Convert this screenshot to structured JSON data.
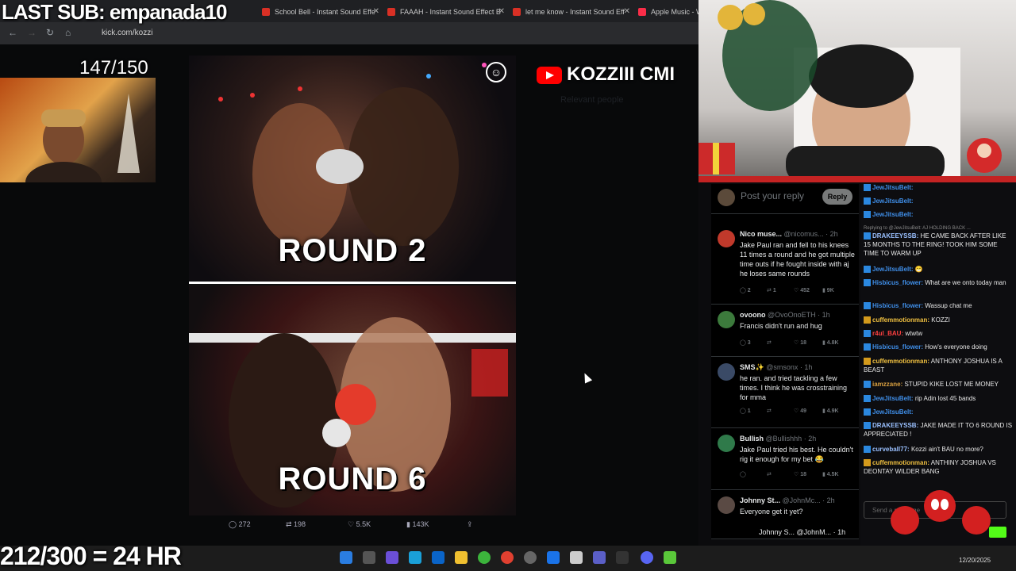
{
  "overlay": {
    "last_sub": "LAST SUB: empanada10",
    "goal_top": "147/150",
    "goal_bottom": "212/300 = 24 HR"
  },
  "browser": {
    "tabs": [
      {
        "label": "School Bell - Instant Sound Effe"
      },
      {
        "label": "FAAAH - Instant Sound Effect B"
      },
      {
        "label": "let me know - Instant Sound Eff"
      },
      {
        "label": "Apple Music - W"
      }
    ],
    "url": "kick.com/kozzi"
  },
  "post": {
    "round_top": "ROUND 2",
    "round_bottom": "ROUND 6",
    "replies": "272",
    "reposts": "198",
    "likes": "5.5K",
    "views": "143K"
  },
  "social_banner": "KOZZIII  CMI",
  "reply_box": {
    "placeholder": "Post your reply",
    "button": "Reply"
  },
  "tweets": [
    {
      "name": "Nico muse...",
      "handle": "@nicomus... · 2h",
      "text": "Jake Paul ran and fell to his knees 11 times a round and he got multiple time outs if he fought inside with aj he loses same rounds",
      "replies": "2",
      "reposts": "1",
      "likes": "452",
      "views": "9K",
      "color": "#c0392b"
    },
    {
      "name": "ovoono",
      "handle": "@OvoOnoETH · 1h",
      "text": "Francis didn't run and hug",
      "replies": "3",
      "reposts": "",
      "likes": "18",
      "views": "4.8K",
      "color": "#3c7a3c"
    },
    {
      "name": "SMS✨",
      "handle": "@smsonx · 1h",
      "text": "he ran. and tried tackling a few times. I think he was crosstraining for mma",
      "replies": "1",
      "reposts": "",
      "likes": "49",
      "views": "4.9K",
      "color": "#3a4a66"
    },
    {
      "name": "Bullish",
      "handle": "@Bullishhh · 2h",
      "text": "Jake Paul tried his best. He couldn't rig it enough for my bet 😂",
      "replies": "",
      "reposts": "",
      "likes": "18",
      "views": "4.5K",
      "color": "#2f7a4a"
    },
    {
      "name": "Johnny St...",
      "handle": "@JohnMc... · 2h",
      "text": "Everyone get it yet?",
      "replies": "",
      "reposts": "",
      "likes": "",
      "views": "",
      "color": "#5a4a44"
    }
  ],
  "tweet_sub": "Johnny S... @JohnM... · 1h",
  "chat": [
    {
      "user": "JewJitsuBelt:",
      "text": "",
      "color": "#3f8ee8"
    },
    {
      "user": "JewJitsuBelt:",
      "text": "",
      "color": "#3f8ee8"
    },
    {
      "user": "JewJitsuBelt:",
      "text": "",
      "color": "#3f8ee8"
    },
    {
      "user": "",
      "text": "Replying to @JewJitsuBelt: AJ HOLDING BACK ...",
      "color": "#888"
    },
    {
      "user": "DRAKEEYSSB:",
      "text": "HE CAME BACK AFTER LIKE 15 MONTHS TO THE RING! TOOK HIM SOME TIME TO WARM UP",
      "color": "#9ac0ff"
    },
    {
      "user": "JewJitsuBelt:",
      "text": "😁",
      "color": "#3f8ee8"
    },
    {
      "user": "Hisbicus_flower:",
      "text": "What are we onto today man",
      "color": "#3f8ee8"
    },
    {
      "user": "Hisbicus_flower:",
      "text": "Wassup chat me",
      "color": "#3f8ee8"
    },
    {
      "user": "cuffemmotionman:",
      "text": "KOZZI",
      "color": "#f0c040"
    },
    {
      "user": "r4ul_BAU:",
      "text": "wtwtw",
      "color": "#ff4040"
    },
    {
      "user": "Hisbicus_flower:",
      "text": "How's everyone doing",
      "color": "#3f8ee8"
    },
    {
      "user": "cuffemmotionman:",
      "text": "ANTHONY JOSHUA IS A BEAST",
      "color": "#f0c040"
    },
    {
      "user": "iamzzane:",
      "text": "STUPID KIKE LOST ME MONEY",
      "color": "#d9a040"
    },
    {
      "user": "JewJitsuBelt:",
      "text": "rip Adin lost 45 bands",
      "color": "#3f8ee8"
    },
    {
      "user": "JewJitsuBelt:",
      "text": "",
      "color": "#3f8ee8"
    },
    {
      "user": "DRAKEEYSSB:",
      "text": "JAKE MADE IT TO 6 ROUND IS APPRECIATED !",
      "color": "#9ac0ff"
    },
    {
      "user": "curveball77:",
      "text": "Kozzi ain't BAU no more?",
      "color": "#9ac0ff"
    },
    {
      "user": "cuffemmotionman:",
      "text": "ANTHINY JOSHUA VS DEONTAY WILDER BANG",
      "color": "#f0c040"
    }
  ],
  "chat_input": {
    "placeholder": "Send a message"
  },
  "taskbar": {
    "date": "12/20/2025"
  }
}
